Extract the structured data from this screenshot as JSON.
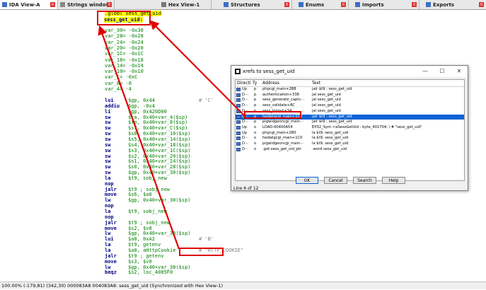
{
  "tabs": [
    {
      "label": "IDA View-A",
      "active": true
    },
    {
      "label": "Strings window"
    },
    {
      "label": "Hex View-1"
    },
    {
      "label": "Structures"
    },
    {
      "label": "Enums"
    },
    {
      "label": "Imports"
    },
    {
      "label": "Exports"
    }
  ],
  "code": {
    "globl": ".globl sess_get_uid",
    "label": "sess_get_uid:",
    "vars": [
      {
        "name": "var_30=",
        "val": "-0x30"
      },
      {
        "name": "var_28=",
        "val": "-0x28"
      },
      {
        "name": "var_24=",
        "val": "-0x24"
      },
      {
        "name": "var_20=",
        "val": "-0x20"
      },
      {
        "name": "var_1C=",
        "val": "-0x1C"
      },
      {
        "name": "var_18=",
        "val": "-0x18"
      },
      {
        "name": "var_14=",
        "val": "-0x14"
      },
      {
        "name": "var_10=",
        "val": "-0x10"
      },
      {
        "name": "var_C=",
        "val": "-0xC"
      },
      {
        "name": "var_8=",
        "val": "-8"
      },
      {
        "name": "var_4=",
        "val": "-4"
      }
    ],
    "instr": [
      {
        "m": "lui",
        "o": "$gp, 0x44",
        "c": "# 'C'"
      },
      {
        "m": "addiu",
        "o": "$gp, -0x4",
        "c": ""
      },
      {
        "m": "li",
        "o": "$gp, 0x420D00",
        "c": ""
      },
      {
        "m": "sw",
        "o": "$ra, 0x40+var_4($sp)",
        "c": ""
      },
      {
        "m": "sw",
        "o": "$fp, 0x40+var_8($sp)",
        "c": ""
      },
      {
        "m": "sw",
        "o": "$s7, 0x40+var_C($sp)",
        "c": ""
      },
      {
        "m": "sw",
        "o": "$s6, 0x40+var_10($sp)",
        "c": ""
      },
      {
        "m": "sw",
        "o": "$s5, 0x40+var_14($sp)",
        "c": ""
      },
      {
        "m": "sw",
        "o": "$s4, 0x40+var_18($sp)",
        "c": ""
      },
      {
        "m": "sw",
        "o": "$s3, 0x40+var_1C($sp)",
        "c": ""
      },
      {
        "m": "sw",
        "o": "$s2, 0x40+var_20($sp)",
        "c": ""
      },
      {
        "m": "sw",
        "o": "$s1, 0x40+var_24($sp)",
        "c": ""
      },
      {
        "m": "sw",
        "o": "$s0, 0x40+var_28($sp)",
        "c": ""
      },
      {
        "m": "sw",
        "o": "$gp, 0x40+var_30($sp)",
        "c": ""
      },
      {
        "m": "la",
        "o": "$t9, sobj_new",
        "c": ""
      },
      {
        "m": "nop",
        "o": "",
        "c": ""
      },
      {
        "m": "jalr",
        "o": "$t9 ; sobj_new",
        "c": ""
      },
      {
        "m": "move",
        "o": "$s6, $a0",
        "c": ""
      },
      {
        "m": "lw",
        "o": "$gp, 0x40+var_30($sp)",
        "c": ""
      },
      {
        "m": "nop",
        "o": "",
        "c": ""
      },
      {
        "m": "la",
        "o": "$t9, sobj_new",
        "c": ""
      },
      {
        "m": "nop",
        "o": "",
        "c": ""
      },
      {
        "m": "jalr",
        "o": "$t9 ; sobj_new",
        "c": ""
      },
      {
        "m": "move",
        "o": "$s2, $v0",
        "c": ""
      },
      {
        "m": "lw",
        "o": "$gp, 0x40+var_30($sp)",
        "c": ""
      },
      {
        "m": "lui",
        "o": "$a0, 0xA2",
        "c": "# 'B'"
      },
      {
        "m": "la",
        "o": "$t9, getenv",
        "c": ""
      },
      {
        "m": "la",
        "o": "$a0, aHttpCookie",
        "c": "# \"HTTP_COOKIE\""
      },
      {
        "m": "jalr",
        "o": "$t9 ; getenv",
        "c": ""
      },
      {
        "m": "move",
        "o": "$s3, $v0",
        "c": ""
      },
      {
        "m": "lw",
        "o": "$gp, 0x40+var_30($sp)",
        "c": ""
      },
      {
        "m": "beqz",
        "o": "$s2, loc_4085F0",
        "c": ""
      }
    ]
  },
  "status": "100.00% (-179,81) (342,30) 000083A8 004083A8: sess_get_uid (Synchronized with Hex View-1)",
  "dialog": {
    "title": "xrefs to sess_get_uid",
    "columns": [
      "Directi",
      "Ty",
      "Address",
      "Text"
    ],
    "rows": [
      {
        "dir": "Up",
        "ty": "p",
        "addr": "phpcgi_main+2B8",
        "text": "jalr    $t9 ; sess_get_uid"
      },
      {
        "dir": "D···",
        "ty": "p",
        "addr": "authentication+338",
        "text": "jal     sess_get_uid"
      },
      {
        "dir": "D···",
        "ty": "p",
        "addr": "sess_generate_captc···",
        "text": "jal     sess_get_uid"
      },
      {
        "dir": "D···",
        "ty": "p",
        "addr": "sess_validate+8C",
        "text": "jal     sess_get_uid"
      },
      {
        "dir": "D···",
        "ty": "p",
        "addr": "sess_logout+34",
        "text": "jal     sess_get_uid"
      },
      {
        "dir": "D···",
        "ty": "p",
        "addr": "hedwigcgi_main+1C8",
        "text": "jalr    $t9 ; sess_get_uid",
        "sel": true
      },
      {
        "dir": "D···",
        "ty": "p",
        "addr": "pigwidgeoncgi_main···",
        "text": "jalr    $t9 ; sess_get_uid"
      },
      {
        "dir": "Up",
        "ty": "o",
        "addr": "LOAD:00400A54",
        "text": "Elf32_Sym <aSessGetUid - byte_401704, \\ # \"sess_get_uid\""
      },
      {
        "dir": "Up",
        "ty": "o",
        "addr": "phpcgi_main+2B0",
        "text": "la      $t9, sess_get_uid"
      },
      {
        "dir": "D···",
        "ty": "o",
        "addr": "hedwigcgi_main+1C0",
        "text": "la      $t9, sess_get_uid"
      },
      {
        "dir": "D···",
        "ty": "o",
        "addr": "pigwidgeoncgi_main···",
        "text": "la      $t9, sess_get_uid"
      },
      {
        "dir": "D···",
        "ty": "o",
        "addr": ".got:sess_get_uid_ptr",
        "text": ".word sess_get_uid"
      }
    ],
    "buttons": [
      "OK",
      "Cancel",
      "Search",
      "Help"
    ],
    "status": "Line 6 of 12"
  }
}
